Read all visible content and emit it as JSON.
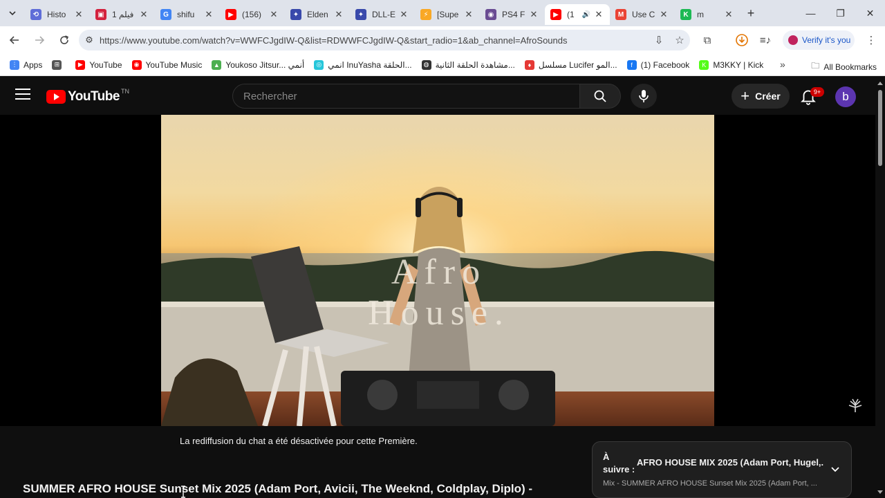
{
  "browser": {
    "tabs": [
      {
        "label": "Histo",
        "color": "#5f6dd8",
        "glyph": "⟲",
        "active": false
      },
      {
        "label": "1 فيلم",
        "color": "#d3213d",
        "glyph": "▣",
        "active": false
      },
      {
        "label": "shifu",
        "color": "#4285f4",
        "glyph": "G",
        "active": false
      },
      {
        "label": "(156)",
        "color": "#ff0000",
        "glyph": "▶",
        "active": false
      },
      {
        "label": "Elden",
        "color": "#3949ab",
        "glyph": "✦",
        "active": false
      },
      {
        "label": "DLL-E",
        "color": "#3949ab",
        "glyph": "✦",
        "active": false
      },
      {
        "label": "[Supe",
        "color": "#f9a825",
        "glyph": "⚡",
        "active": false
      },
      {
        "label": "PS4 F",
        "color": "#6a4c93",
        "glyph": "◉",
        "active": false
      },
      {
        "label": "(1",
        "color": "#ff0000",
        "glyph": "▶",
        "active": true
      },
      {
        "label": "Use C",
        "color": "#ea4335",
        "glyph": "M",
        "active": false
      },
      {
        "label": "m",
        "color": "#1db954",
        "glyph": "K",
        "active": false
      }
    ],
    "url": "https://www.youtube.com/watch?v=WWFCJgdIW-Q&list=RDWWFCJgdIW-Q&start_radio=1&ab_channel=AfroSounds",
    "verify_label": "Verify it's you",
    "bookmarks": [
      {
        "label": "Apps",
        "color": "#4285f4",
        "glyph": "⋮"
      },
      {
        "label": "",
        "color": "#555555",
        "glyph": "⊞"
      },
      {
        "label": "YouTube",
        "color": "#ff0000",
        "glyph": "▶"
      },
      {
        "label": "YouTube Music",
        "color": "#ff0000",
        "glyph": "◉"
      },
      {
        "label": "Youkoso Jitsur... أنمي",
        "color": "#4caf50",
        "glyph": "▲"
      },
      {
        "label": "انمي InuYasha الحلقة...",
        "color": "#26c6da",
        "glyph": "◎"
      },
      {
        "label": "مشاهدة الحلقة الثانية...",
        "color": "#333333",
        "glyph": "◍"
      },
      {
        "label": "مسلسل Lucifer المو...",
        "color": "#e53935",
        "glyph": "♦"
      },
      {
        "label": "(1) Facebook",
        "color": "#1877f2",
        "glyph": "f"
      },
      {
        "label": "M3KKY | Kick",
        "color": "#53fc18",
        "glyph": "K"
      }
    ],
    "all_bookmarks": "All Bookmarks"
  },
  "youtube": {
    "logo_text": "YouTube",
    "region": "TN",
    "search_placeholder": "Rechercher",
    "create_label": "Créer",
    "notifications_badge": "9+",
    "avatar_letter": "b",
    "video_overlay_text": "Afro House.",
    "chat_note": "La rediffusion du chat a été désactivée pour cette Première.",
    "title": "SUMMER AFRO HOUSE Sunset Mix 2025 (Adam Port, Avicii, The Weeknd, Coldplay, Diplo) -",
    "up_next": {
      "label": "À suivre :",
      "title": "AFRO HOUSE MIX 2025 (Adam Port, Hugel,...",
      "subtitle": "Mix - SUMMER AFRO HOUSE Sunset Mix 2025 (Adam Port, ..."
    }
  },
  "colors": {
    "yt_red": "#ff0000",
    "yt_bg": "#0f0f0f",
    "tabstrip": "#dfe3eb"
  }
}
